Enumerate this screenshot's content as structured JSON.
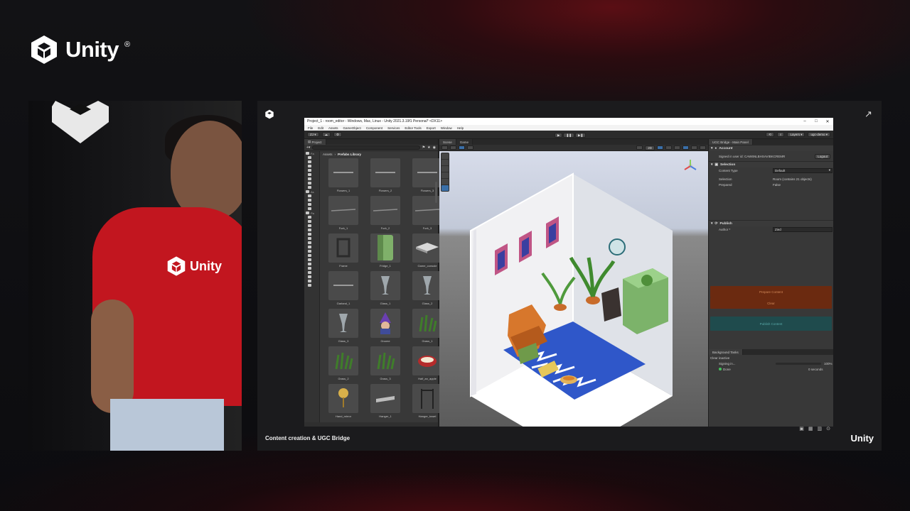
{
  "brand": {
    "name": "Unity",
    "reg": "®"
  },
  "presenter": {
    "shirt_text": "Unity"
  },
  "screen": {
    "caption": "Content creation & UGC Bridge",
    "footer_brand": "Unity"
  },
  "editor": {
    "window_title": "Project_1 - room_editor - Windows, Mac, Linux - Unity 2021.3.19f1 Personal* <DX11>",
    "menu": [
      "File",
      "Edit",
      "Assets",
      "GameObject",
      "Component",
      "Services",
      "Editor Tools",
      "Export",
      "Window",
      "Help"
    ],
    "toolbar": {
      "account": "ZJ",
      "layers": "Layers",
      "layout": "ugc-demo"
    },
    "project_tab": "Project",
    "breadcrumb": {
      "root": "Assets",
      "current": "Prefabs Library"
    },
    "tree_labels": [
      "Fa",
      "As",
      "Pa"
    ],
    "assets": [
      {
        "label": "Flowers_1",
        "kind": "flat"
      },
      {
        "label": "Flowers_2",
        "kind": "flat"
      },
      {
        "label": "Flowers_3",
        "kind": "flat"
      },
      {
        "label": "Fork_1",
        "kind": "stick"
      },
      {
        "label": "Fork_2",
        "kind": "stick"
      },
      {
        "label": "Fork_3",
        "kind": "stick"
      },
      {
        "label": "Frame",
        "kind": "frame"
      },
      {
        "label": "Fridge_1",
        "kind": "fridge"
      },
      {
        "label": "Game_console",
        "kind": "console"
      },
      {
        "label": "Garland_1",
        "kind": "flat"
      },
      {
        "label": "Glass_1",
        "kind": "glass"
      },
      {
        "label": "Glass_2",
        "kind": "glass"
      },
      {
        "label": "Glass_3",
        "kind": "glass"
      },
      {
        "label": "Gnome",
        "kind": "gnome"
      },
      {
        "label": "Grass_1",
        "kind": "grass"
      },
      {
        "label": "Grass_2",
        "kind": "grass"
      },
      {
        "label": "Grass_3",
        "kind": "grass"
      },
      {
        "label": "Half_an_apple",
        "kind": "apple"
      },
      {
        "label": "Hand_mirror",
        "kind": "mirror"
      },
      {
        "label": "Hanger_1",
        "kind": "hanger"
      },
      {
        "label": "Hanger_towel",
        "kind": "towel"
      }
    ],
    "scene_tabs": [
      "Scene",
      "Game"
    ],
    "scene_toolbar": {
      "mode": "2D"
    },
    "ugc": {
      "title": "UGC Bridge - Main Panel",
      "account_header": "Account",
      "signed_in": "Signed in user id: CAW6NLBHSAVIBKCREMR",
      "logout": "Logout",
      "selection_header": "Selection",
      "content_type_label": "Content Type",
      "content_type_value": "Default",
      "selection_label": "Selection",
      "selection_value": "Room (contains 21 objects)",
      "prepared_label": "Prepared",
      "prepared_value": "False",
      "publish_header": "Publish",
      "author_label": "Author *",
      "author_value": "Zied",
      "prepare_btn": "Prepare Content",
      "clear_btn": "Clear",
      "publish_btn": "Publish Content",
      "bg_tasks_tab": "Background Tasks",
      "clear_inactive": "Clear inactive",
      "task1_label": "Signing in...",
      "task1_percent": "100%",
      "task1_progress": 1.0,
      "task2_label": "Done",
      "task2_time": "0 seconds"
    }
  },
  "colors": {
    "prepare": "#6b2a10",
    "clear": "#6b2a10",
    "publish": "#1f4b4d",
    "unity_red": "#c2161f"
  }
}
